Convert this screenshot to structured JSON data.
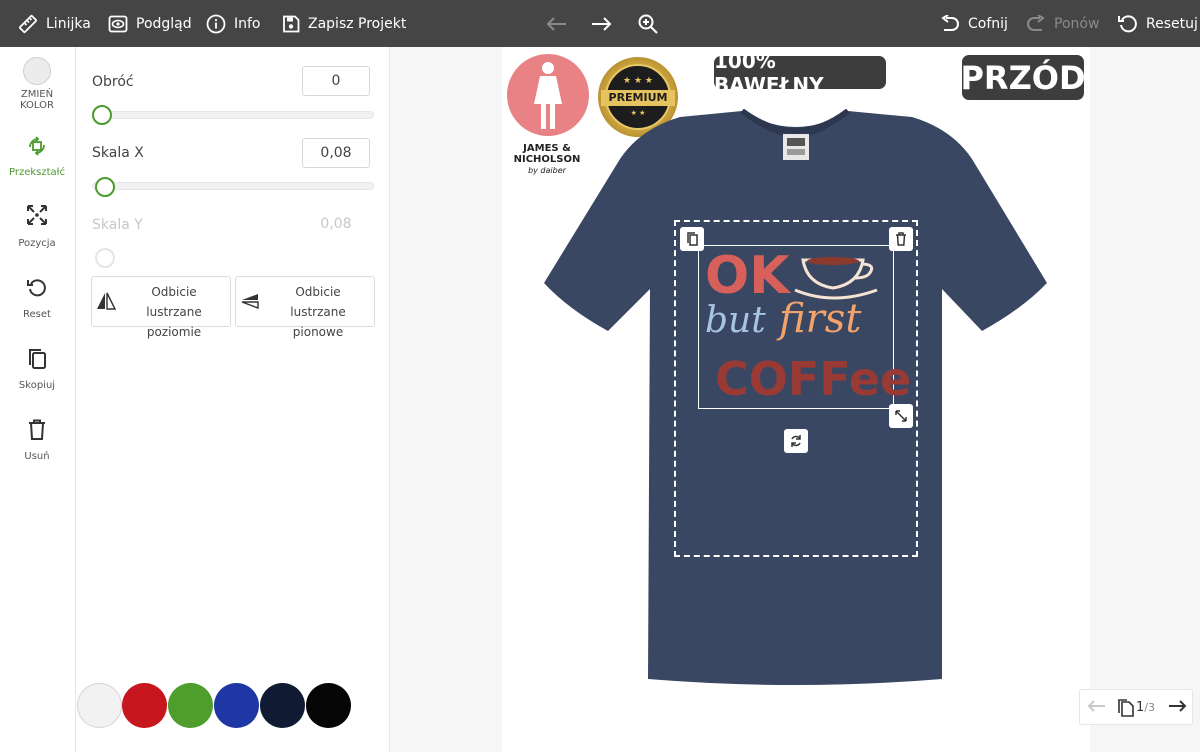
{
  "toolbar": {
    "ruler": "Linijka",
    "preview": "Podgląd",
    "info": "Info",
    "save": "Zapisz Projekt",
    "undo": "Cofnij",
    "redo": "Ponów",
    "reset": "Resetuj"
  },
  "sidebar": {
    "change_color": "ZMIEŃ KOLOR",
    "transform": "Przekształć",
    "position": "Pozycja",
    "reset": "Reset",
    "copy": "Skopiuj",
    "delete": "Usuń"
  },
  "panel": {
    "rotate_label": "Obróć",
    "rotate_value": "0",
    "scale_x_label": "Skala X",
    "scale_x_value": "0,08",
    "scale_y_label": "Skala Y",
    "scale_y_value": "0,08",
    "mirror_h": "Odbicie lustrzane poziomie",
    "mirror_v": "Odbicie lustrzane pionowe"
  },
  "palette": [
    "#f2f2f2",
    "#c7161e",
    "#4e9d2d",
    "#1f37a5",
    "#101a33",
    "#060606"
  ],
  "product": {
    "badge_cotton": "100% BAWEŁNY",
    "badge_side": "PRZÓD",
    "premium": "PREMIUM",
    "brand_line1": "JAMES &",
    "brand_line2": "NICHOLSON",
    "brand_line3": "by daiber",
    "shirt_color": "#3a4763"
  },
  "design": {
    "line1": "OK",
    "line2a": "but",
    "line2b": "first",
    "line3": "COFFee"
  },
  "pager": {
    "current": "1",
    "total": "/3"
  }
}
